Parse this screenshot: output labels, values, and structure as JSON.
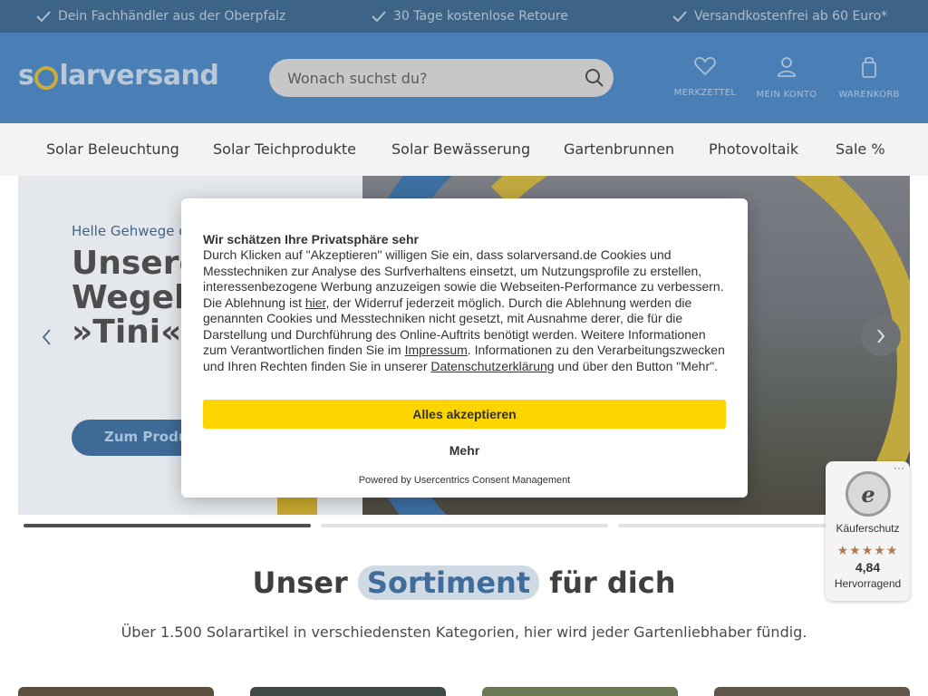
{
  "topbar": {
    "usps": [
      "Dein Fachhändler aus der Oberpfalz",
      "30 Tage kostenlose Retoure",
      "Versandkostenfrei ab 60 Euro*"
    ]
  },
  "header": {
    "logo": {
      "prefix": "s",
      "suffix": "larversand"
    },
    "search_placeholder": "Wonach suchst du?",
    "icons": [
      {
        "label": "MERKZETTEL",
        "icon": "heart-icon"
      },
      {
        "label": "MEIN KONTO",
        "icon": "user-icon"
      },
      {
        "label": "WARENKORB",
        "icon": "cart-icon"
      }
    ]
  },
  "nav": {
    "items": [
      "Solar Beleuchtung",
      "Solar Teichprodukte",
      "Solar Bewässerung",
      "Gartenbrunnen",
      "Photovoltaik",
      "Sale %"
    ]
  },
  "hero": {
    "subtitle": "Helle Gehwege o",
    "title_lines": [
      "Unsere",
      "Wegel",
      "»Tini«"
    ],
    "button": "Zum Produkt",
    "progress": [
      1,
      0,
      0
    ]
  },
  "section": {
    "title_before": "Unser",
    "title_highlight": "Sortiment",
    "title_after": "für dich",
    "subtitle": "Über 1.500 Solarartikel in verschiedensten Kategorien, hier wird jeder Gartenliebhaber fündig."
  },
  "consent": {
    "heading": "Wir schätzen Ihre Privatsphäre sehr",
    "text_1": "Durch Klicken auf \"Akzeptieren\" willigen Sie ein, dass solarversand.de Cookies und Messtechniken zur Analyse des Surfverhaltens einsetzt, um Nutzungsprofile zu erstellen, interessenbezogene Werbung anzuzeigen sowie die Webseiten-Performance zu verbessern. Die Ablehnung ist ",
    "link_hier": "hier",
    "text_2": ", der Widerruf jederzeit möglich. Durch die Ablehnung werden die genannten Cookies und Messtechniken nicht gesetzt, mit Ausnahme derer, die für die Darstellung und Durchführung des Online-Auftrits benötigt werden. Weitere Informationen zum Verantwortlichen finden Sie im ",
    "link_impressum": "Impressum",
    "text_3": ". Informationen zu den Verarbeitungszwecken und Ihren Rechten finden Sie in unserer ",
    "link_datenschutz": "Datenschutzerklärung",
    "text_4": " und über den Button \"Mehr\".",
    "accept_label": "Alles akzeptieren",
    "more_label": "Mehr",
    "powered_by": "Powered by Usercentrics Consent Management"
  },
  "trusted": {
    "dots": "···",
    "seal_letter": "e",
    "label": "Käuferschutz",
    "stars": "★★★★★",
    "rating": "4,84",
    "verdict": "Hervorragend"
  },
  "colors": {
    "brand_blue": "#4a7fb6",
    "accept_yellow": "#fcd400",
    "star_color": "#b07a52"
  }
}
